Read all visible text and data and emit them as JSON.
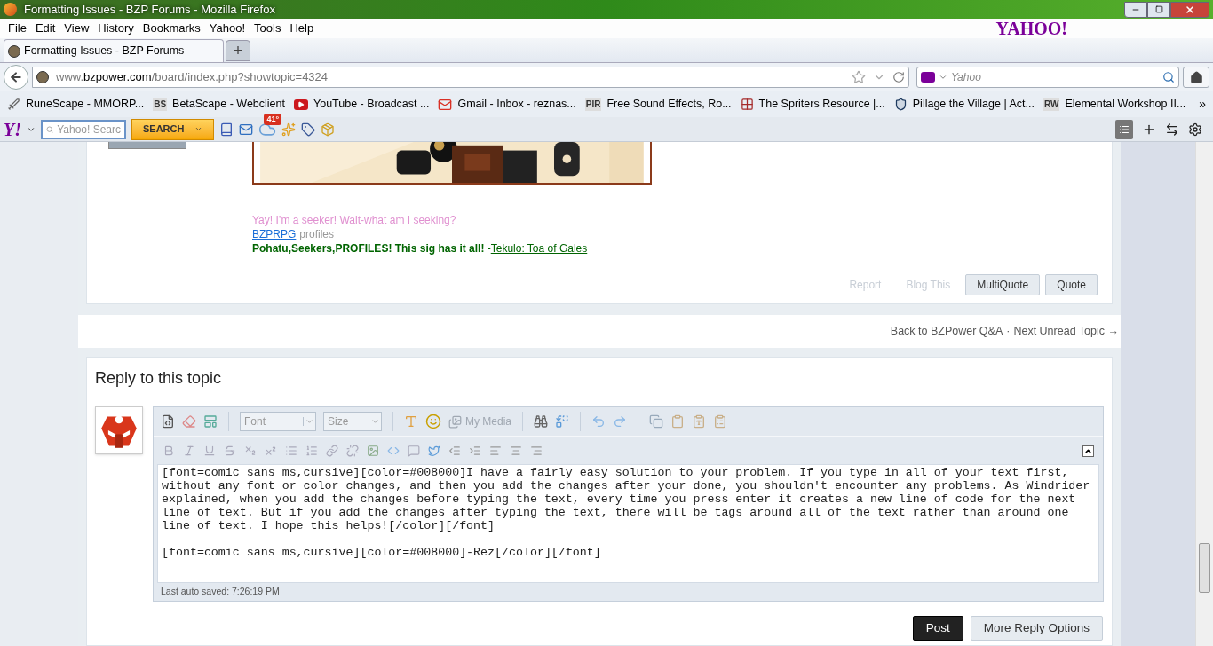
{
  "window": {
    "title": "Formatting Issues - BZP Forums - Mozilla Firefox"
  },
  "menu": [
    "File",
    "Edit",
    "View",
    "History",
    "Bookmarks",
    "Yahoo!",
    "Tools",
    "Help"
  ],
  "menu_logo": "YAHOO!",
  "tabs": [
    {
      "label": "Formatting Issues - BZP Forums",
      "selected": true
    }
  ],
  "new_tab": "+",
  "address": "www.**bzpower.com**/board/index.php?showtopic=4324",
  "search": {
    "placeholder": "Yahoo"
  },
  "bookmarks": [
    {
      "label": "RuneScape - MMORP...",
      "kind": "sword"
    },
    {
      "label": "BetaScape - Webclient",
      "kind": "letters",
      "badge": "BS"
    },
    {
      "label": "YouTube - Broadcast ...",
      "kind": "play"
    },
    {
      "label": "Gmail - Inbox - reznas...",
      "kind": "mail"
    },
    {
      "label": "Free Sound Effects, Ro...",
      "kind": "letters",
      "badge": "PIR"
    },
    {
      "label": "The Spriters Resource |...",
      "kind": "grid"
    },
    {
      "label": "Pillage the Village | Act...",
      "kind": "shield"
    },
    {
      "label": "Elemental Workshop II...",
      "kind": "letters",
      "badge": "RW"
    }
  ],
  "bookmarks_overflow": "»",
  "yahoo_toolbar": {
    "logo": "Y!",
    "search_placeholder": "Yahoo! Searc",
    "search_button": "SEARCH",
    "weather": "41°"
  },
  "post": {
    "signature": {
      "quote": "Yay! I’m a seeker! Wait-what am I seeking?",
      "link": "BZPRPG",
      "link_suffix": "profiles",
      "tagline": "Pohatu,Seekers,PROFILES! This sig has it all! -",
      "credit": "Tekulo: Toa of Gales"
    },
    "actions": [
      {
        "label": "Report",
        "kind": "link"
      },
      {
        "label": "Blog This",
        "kind": "link"
      },
      {
        "label": "MultiQuote",
        "kind": "button"
      },
      {
        "label": "Quote",
        "kind": "button"
      }
    ]
  },
  "topic_nav": {
    "back": "Back to BZPower Q&A",
    "separator": "·",
    "next": "Next Unread Topic →"
  },
  "reply": {
    "title": "Reply to this topic",
    "font": "Font",
    "size": "Size",
    "media": "My Media",
    "text": "[font=comic sans ms,cursive][color=#008000]I have a fairly easy solution to your problem. If you type in all of your text first, without any font or color changes, and then you add the changes after your done, you shouldn't encounter any problems. As Windrider explained, when you add the changes before typing the text, every time you press enter it creates a new line of code for the next line of text. But if you add the changes after typing the text, there will be tags around all of the text rather than around one line of text. I hope this helps![/color][/font]\n\n[font=comic sans ms,cursive][color=#008000]-Rez[/color][/font]",
    "autosave": "Last auto saved: 7:26:19 PM",
    "buttons": [
      {
        "label": "Post",
        "kind": "primary"
      },
      {
        "label": "More Reply Options",
        "kind": "secondary"
      }
    ]
  }
}
